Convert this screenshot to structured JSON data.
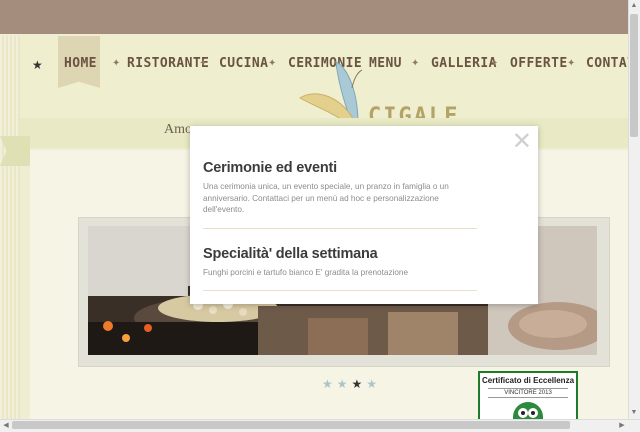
{
  "nav": {
    "items": [
      {
        "label": "HOME"
      },
      {
        "label": "RISTORANTE"
      },
      {
        "label": "CUCINA"
      },
      {
        "label": "CERIMONIE"
      },
      {
        "label": "MENU"
      },
      {
        "label": "GALLERIA"
      },
      {
        "label": "OFFERTE"
      },
      {
        "label": "CONTATT"
      }
    ]
  },
  "logo": {
    "text": "CIGALE"
  },
  "tagline": "Amo",
  "modal": {
    "sections": [
      {
        "title": "Cerimonie ed eventi",
        "text": "Una cerimonia unica, un evento speciale, un pranzo in famiglia o un anniversario. Contattaci per un menù ad hoc e personalizzazione dell'evento."
      },
      {
        "title": "Specialità' della settimana",
        "text": "Funghi porcini e tartufo bianco E' gradita la prenotazione"
      }
    ],
    "close_glyph": "✕"
  },
  "slider": {
    "dot_count": 4,
    "active_index": 2
  },
  "badge": {
    "title": "Certificato di Eccellenza",
    "subtitle": "VINCITORE 2013"
  },
  "colors": {
    "topbar": "#a48d7d",
    "nav_text": "#6b5342",
    "background": "#efeed2",
    "badge_green": "#1f7a2b"
  }
}
